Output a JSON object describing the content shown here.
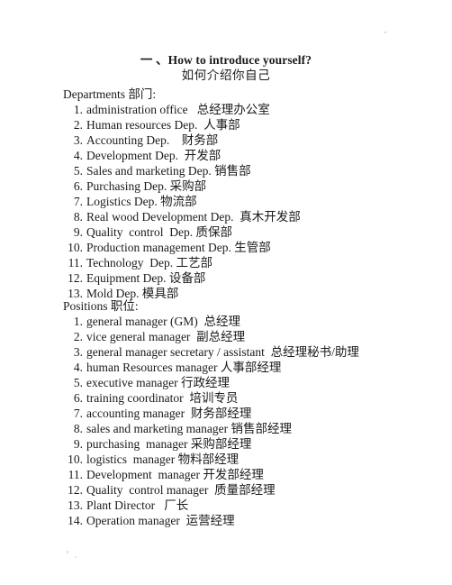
{
  "document": {
    "title_main": "一 、How to introduce yourself?",
    "title_sub": "如何介绍你自己",
    "departments": {
      "heading": "Departments 部门:",
      "items": [
        {
          "num": "1.",
          "text": "administration office   总经理办公室"
        },
        {
          "num": "2.",
          "text": "Human resources Dep.  人事部"
        },
        {
          "num": "3.",
          "text": "Accounting Dep.    财务部"
        },
        {
          "num": "4.",
          "text": "Development Dep.  开发部"
        },
        {
          "num": "5.",
          "text": "Sales and marketing Dep. 销售部"
        },
        {
          "num": "6.",
          "text": "Purchasing Dep. 采购部"
        },
        {
          "num": "7.",
          "text": "Logistics Dep. 物流部"
        },
        {
          "num": "8.",
          "text": "Real wood Development Dep.  真木开发部"
        },
        {
          "num": "9.",
          "text": "Quality  control  Dep. 质保部"
        },
        {
          "num": "10.",
          "text": "Production management Dep. 生管部"
        },
        {
          "num": "11.",
          "text": "Technology  Dep. 工艺部"
        },
        {
          "num": "12.",
          "text": "Equipment Dep. 设备部"
        },
        {
          "num": "13.",
          "text": "Mold Dep. 模具部"
        }
      ]
    },
    "positions": {
      "heading": "Positions 职位:",
      "items": [
        {
          "num": "1.",
          "text": "general manager (GM)  总经理"
        },
        {
          "num": "2.",
          "text": "vice general manager  副总经理"
        },
        {
          "num": "3.",
          "text": "general manager secretary / assistant  总经理秘书/助理"
        },
        {
          "num": "4.",
          "text": "human Resources manager 人事部经理"
        },
        {
          "num": "5.",
          "text": "executive manager 行政经理"
        },
        {
          "num": "6.",
          "text": "training coordinator  培训专员"
        },
        {
          "num": "7.",
          "text": "accounting manager  财务部经理"
        },
        {
          "num": "8.",
          "text": "sales and marketing manager 销售部经理"
        },
        {
          "num": "9.",
          "text": "purchasing  manager 采购部经理"
        },
        {
          "num": "10.",
          "text": "logistics  manager 物料部经理"
        },
        {
          "num": "11.",
          "text": "Development  manager 开发部经理"
        },
        {
          "num": "12.",
          "text": "Quality  control manager  质量部经理"
        },
        {
          "num": "13.",
          "text": "Plant Director   厂长"
        },
        {
          "num": "14.",
          "text": "Operation manager  运营经理"
        }
      ]
    }
  }
}
